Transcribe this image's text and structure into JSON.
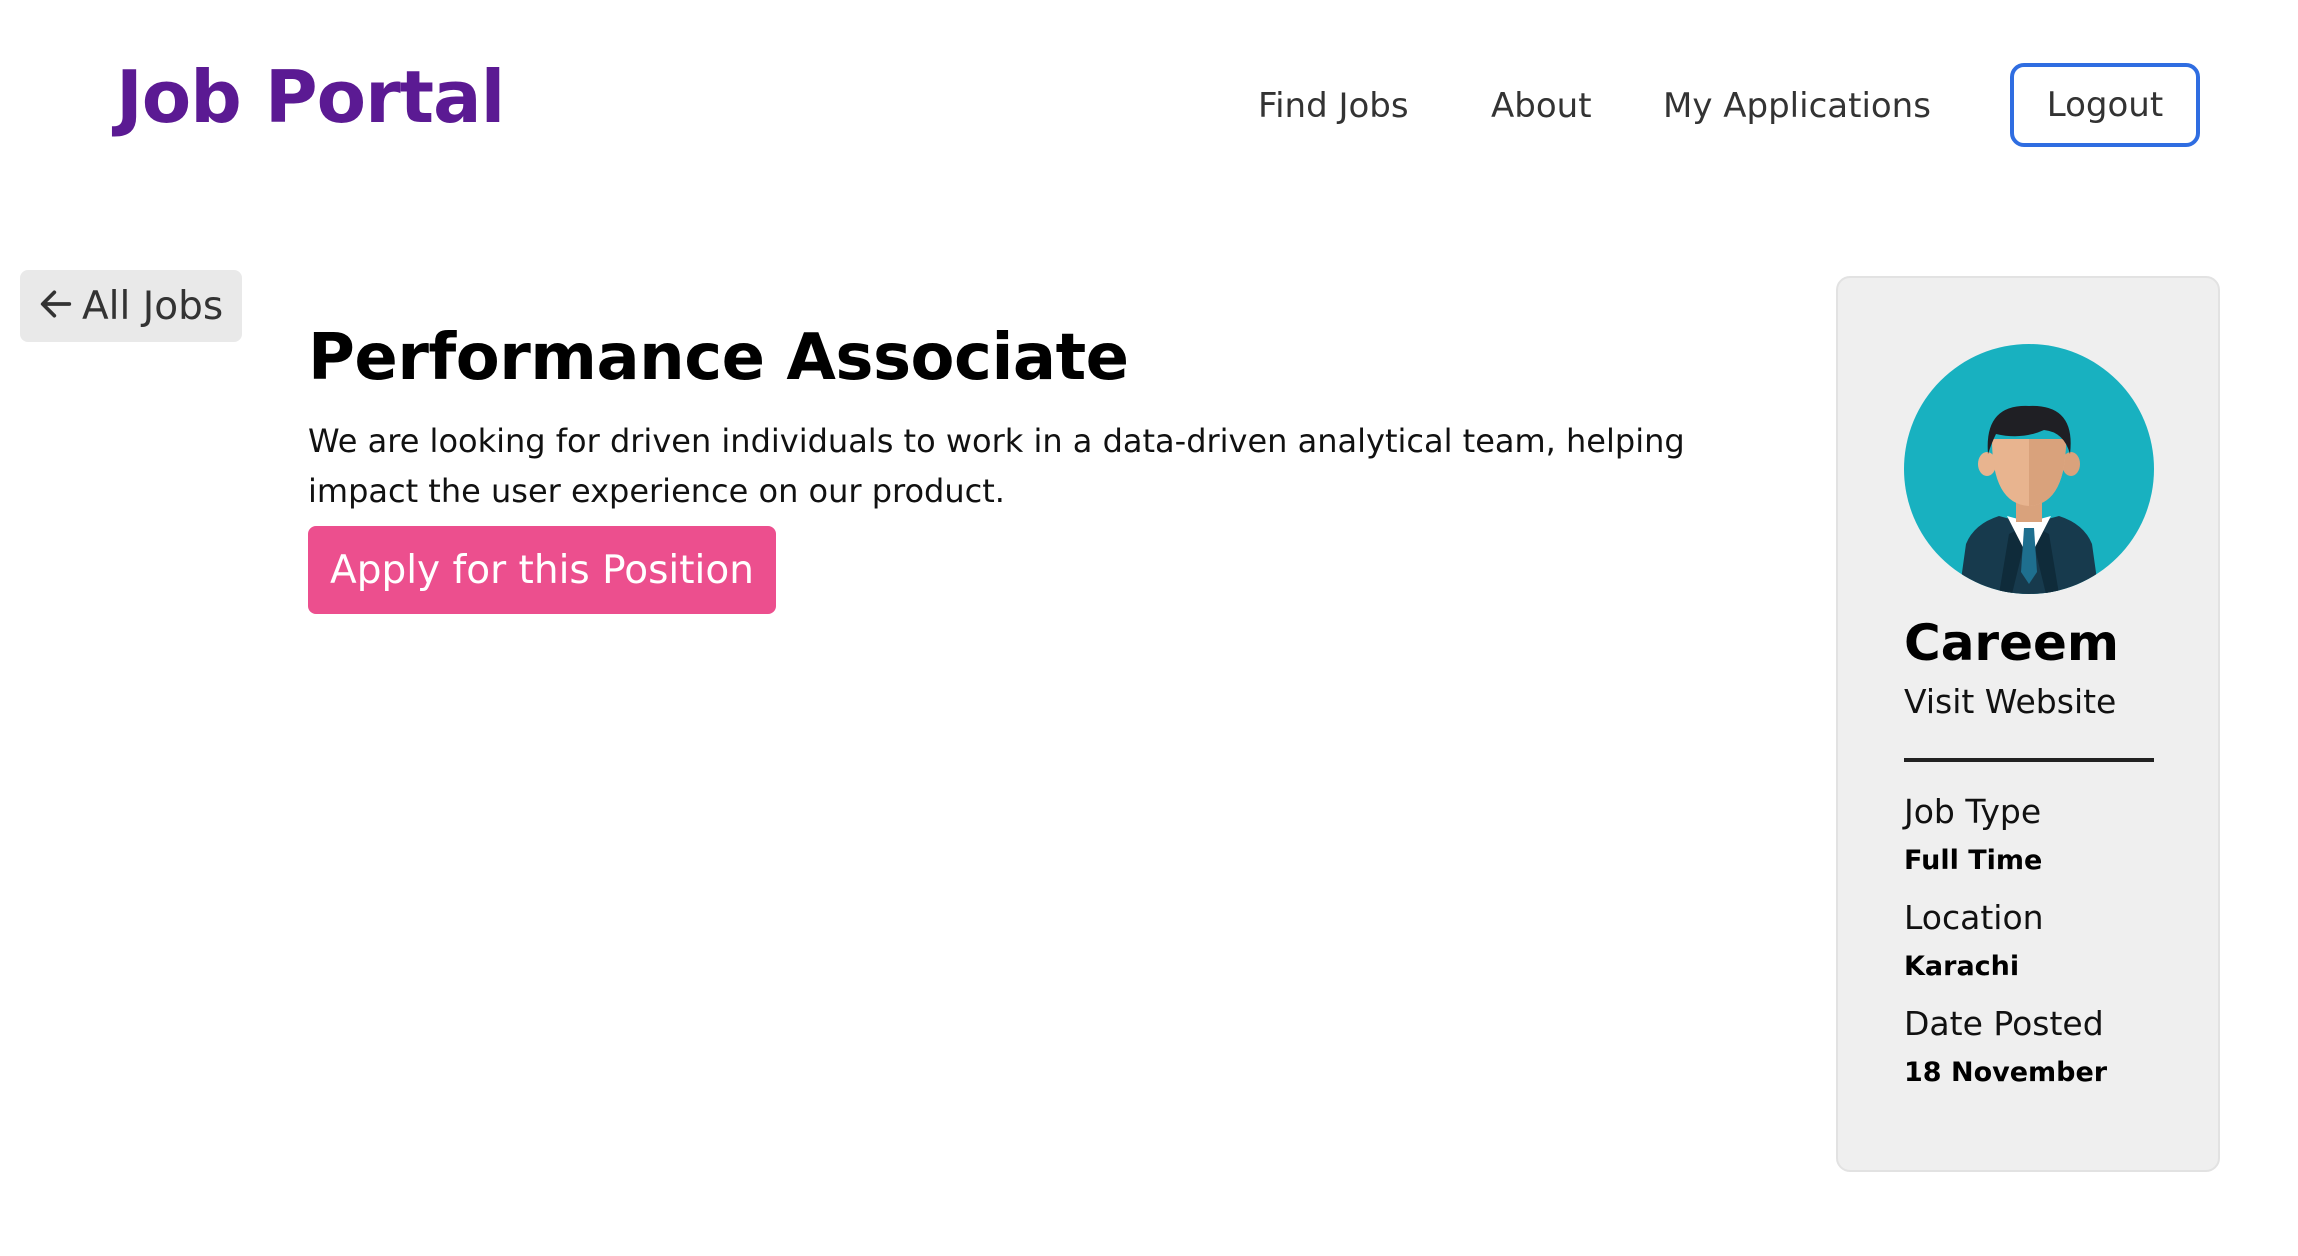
{
  "header": {
    "brand": "Job Portal",
    "nav": {
      "find_jobs": "Find Jobs",
      "about": "About",
      "my_applications": "My Applications",
      "logout": "Logout"
    }
  },
  "back": {
    "label": "All Jobs"
  },
  "job": {
    "title": "Performance Associate",
    "description": "We are looking for driven individuals to work in a data-driven analytical team, helping impact the user experience on our product.",
    "apply_label": "Apply for this Position"
  },
  "company": {
    "name": "Careem",
    "website_label": "Visit Website",
    "details": {
      "job_type_label": "Job Type",
      "job_type_value": "Full Time",
      "location_label": "Location",
      "location_value": "Karachi",
      "date_label": "Date Posted",
      "date_value": "18 November"
    }
  },
  "colors": {
    "brand": "#5b1a93",
    "logout_border": "#2f6de1",
    "apply_button": "#ec4f8e",
    "card_bg": "#efefef",
    "avatar_bg": "#18b1c0"
  },
  "icons": {
    "back": "arrow-left-icon",
    "avatar": "businessman-avatar-icon"
  }
}
